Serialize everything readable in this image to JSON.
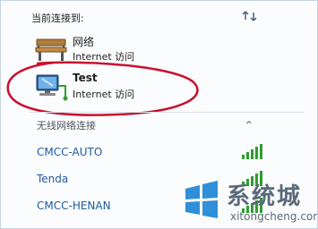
{
  "current_section": {
    "header": "当前连接到:"
  },
  "connections": [
    {
      "name": "网络",
      "status": "Internet 访问",
      "icon": "bench-icon"
    },
    {
      "name": "Test",
      "status": "Internet 访问",
      "icon": "computer-network-icon"
    }
  ],
  "wireless_section": {
    "header": "无线网络连接",
    "caret": "^"
  },
  "wifi_networks": [
    {
      "name": "CMCC-AUTO",
      "signal_bars": 5
    },
    {
      "name": "Tenda",
      "signal_bars": 5
    },
    {
      "name": "CMCC-HENAN",
      "signal_bars": 5
    }
  ],
  "watermark": {
    "title": "系统城",
    "url": "xitongcheng.com"
  },
  "colors": {
    "link_blue": "#1e5c9e",
    "signal_green": "#2e9e2e",
    "annotation_red": "#c8102e"
  }
}
